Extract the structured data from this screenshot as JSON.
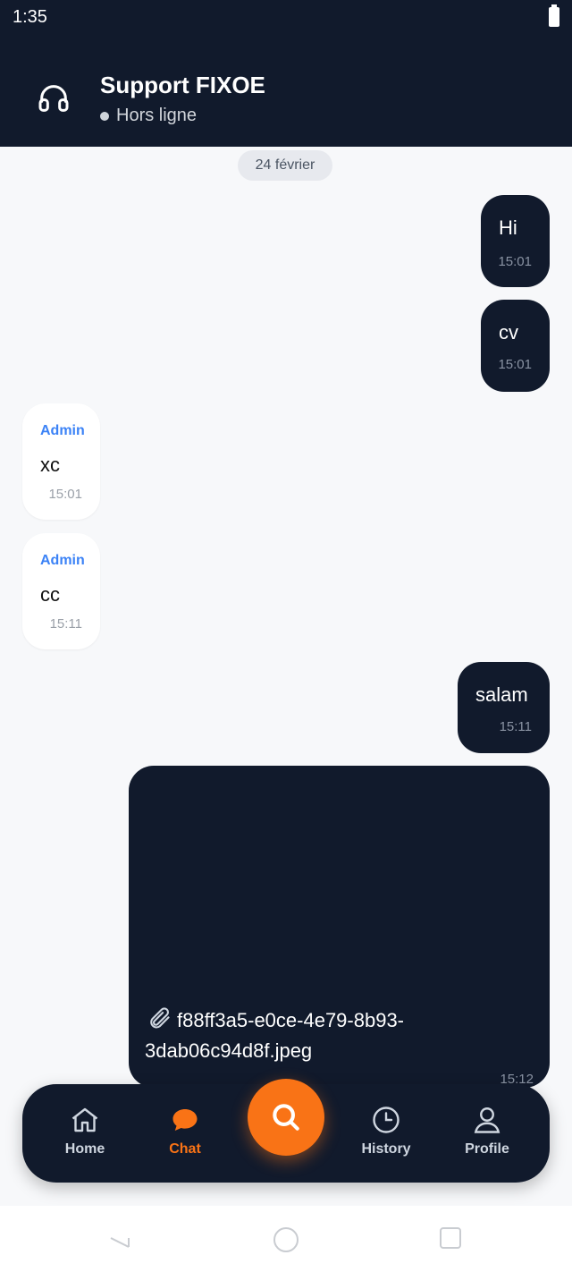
{
  "status_bar": {
    "time": "1:35"
  },
  "header": {
    "title": "Support FIXOE",
    "status": "Hors ligne"
  },
  "chat": {
    "date": "24 février",
    "messages": [
      {
        "direction": "out",
        "text": "Hi",
        "time": "15:01"
      },
      {
        "direction": "out",
        "text": "cv",
        "time": "15:01"
      },
      {
        "direction": "in",
        "sender": "Admin",
        "text": "xc",
        "time": "15:01"
      },
      {
        "direction": "in",
        "sender": "Admin",
        "text": "cc",
        "time": "15:11"
      },
      {
        "direction": "out",
        "text": "salam",
        "time": "15:11"
      },
      {
        "direction": "out",
        "type": "file",
        "file_name": "f88ff3a5-e0ce-4e79-8b93-3dab06c94d8f.jpeg",
        "time": "15:12"
      }
    ]
  },
  "bottom_nav": {
    "items": [
      {
        "label": "Home",
        "icon": "home-icon"
      },
      {
        "label": "Chat",
        "icon": "chat-icon",
        "active": true
      },
      {
        "label": "Search",
        "icon": "search-icon"
      },
      {
        "label": "History",
        "icon": "clock-icon"
      },
      {
        "label": "Profile",
        "icon": "user-icon"
      }
    ]
  },
  "colors": {
    "primary_dark": "#111a2c",
    "accent": "#f97316",
    "admin_name": "#3b82f6"
  }
}
